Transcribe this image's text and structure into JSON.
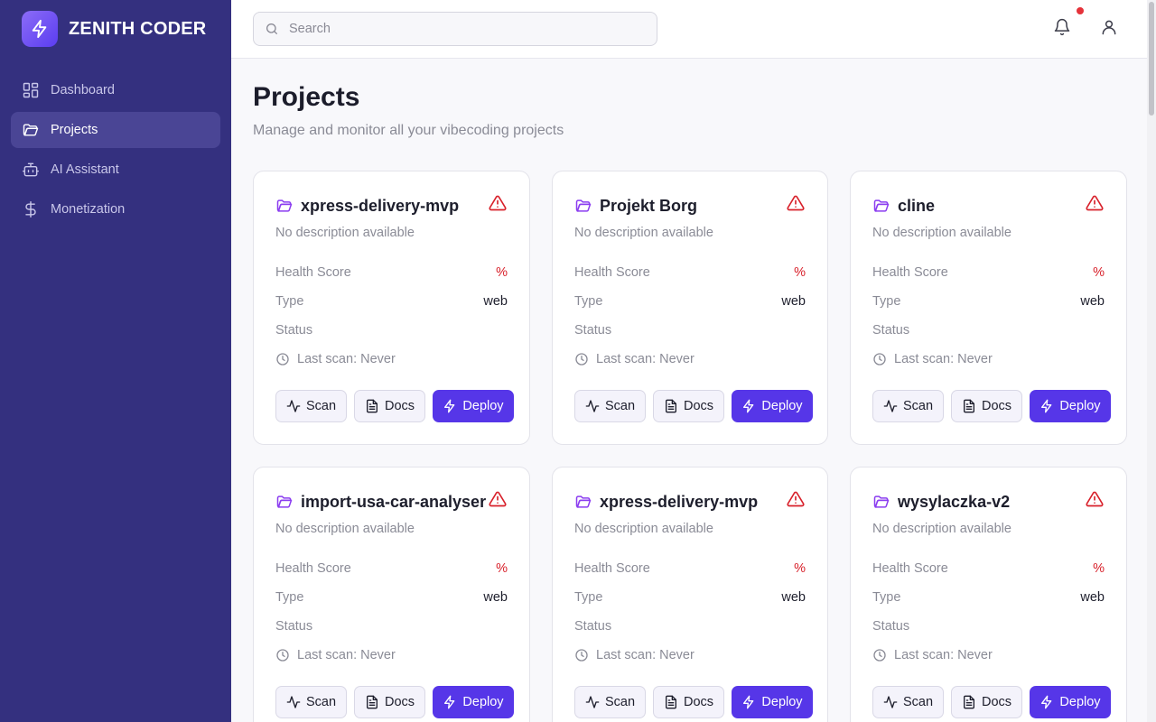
{
  "brand": {
    "name": "ZENITH CODER"
  },
  "nav": [
    {
      "label": "Dashboard",
      "icon": "dashboard-icon",
      "active": false
    },
    {
      "label": "Projects",
      "icon": "folder-icon",
      "active": true
    },
    {
      "label": "AI Assistant",
      "icon": "bot-icon",
      "active": false
    },
    {
      "label": "Monetization",
      "icon": "dollar-icon",
      "active": false
    }
  ],
  "header": {
    "search_placeholder": "Search",
    "notifications_unread": true
  },
  "page": {
    "title": "Projects",
    "subtitle": "Manage and monitor all your vibecoding projects"
  },
  "labels": {
    "health": "Health Score",
    "type": "Type",
    "status": "Status",
    "scan": "Scan",
    "docs": "Docs",
    "deploy": "Deploy"
  },
  "projects": [
    {
      "name": "xpress-delivery-mvp",
      "description": "No description available",
      "health": "%",
      "type": "web",
      "status": "",
      "last_scan": "Last scan: Never"
    },
    {
      "name": "Projekt Borg",
      "description": "No description available",
      "health": "%",
      "type": "web",
      "status": "",
      "last_scan": "Last scan: Never"
    },
    {
      "name": "cline",
      "description": "No description available",
      "health": "%",
      "type": "web",
      "status": "",
      "last_scan": "Last scan: Never"
    },
    {
      "name": "import-usa-car-analyser",
      "description": "No description available",
      "health": "%",
      "type": "web",
      "status": "",
      "last_scan": "Last scan: Never"
    },
    {
      "name": "xpress-delivery-mvp",
      "description": "No description available",
      "health": "%",
      "type": "web",
      "status": "",
      "last_scan": "Last scan: Never"
    },
    {
      "name": "wysylaczka-v2",
      "description": "No description available",
      "health": "%",
      "type": "web",
      "status": "",
      "last_scan": "Last scan: Never"
    }
  ],
  "colors": {
    "sidebar": "#34307f",
    "accent": "#5636e8",
    "danger": "#d8202a",
    "folder": "#8b3df0"
  }
}
